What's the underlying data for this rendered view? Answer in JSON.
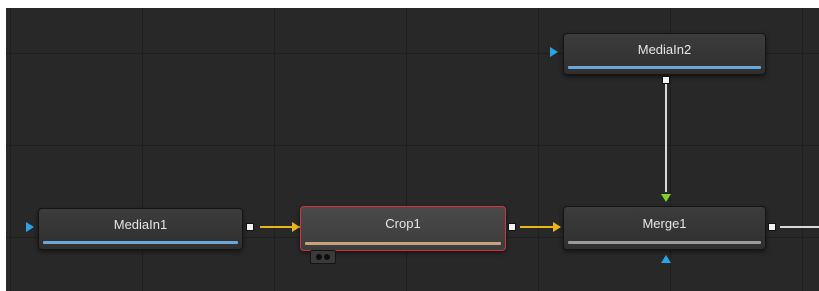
{
  "colors": {
    "canvas_background": "#282828",
    "node_background": "#363636",
    "selected_border": "#d0343a",
    "main_input_arrow": "#2aa4e6",
    "foreground_input_arrow": "#7fcf2e",
    "image_wire": "#e8b51c",
    "default_wire": "#d9d9d9",
    "media_bar": "#6aa6d6",
    "crop_bar": "#c8a27a",
    "merge_bar": "#9a9a9a"
  },
  "nodes": {
    "mediain1": {
      "label": "MediaIn1",
      "icon": "input-arrow-icon"
    },
    "crop1": {
      "label": "Crop1",
      "selected": true,
      "icon": "cache-indicator-icon"
    },
    "mediain2": {
      "label": "MediaIn2",
      "icon": "input-arrow-icon"
    },
    "merge1": {
      "label": "Merge1",
      "icon": "effect-mask-input-icon"
    }
  }
}
